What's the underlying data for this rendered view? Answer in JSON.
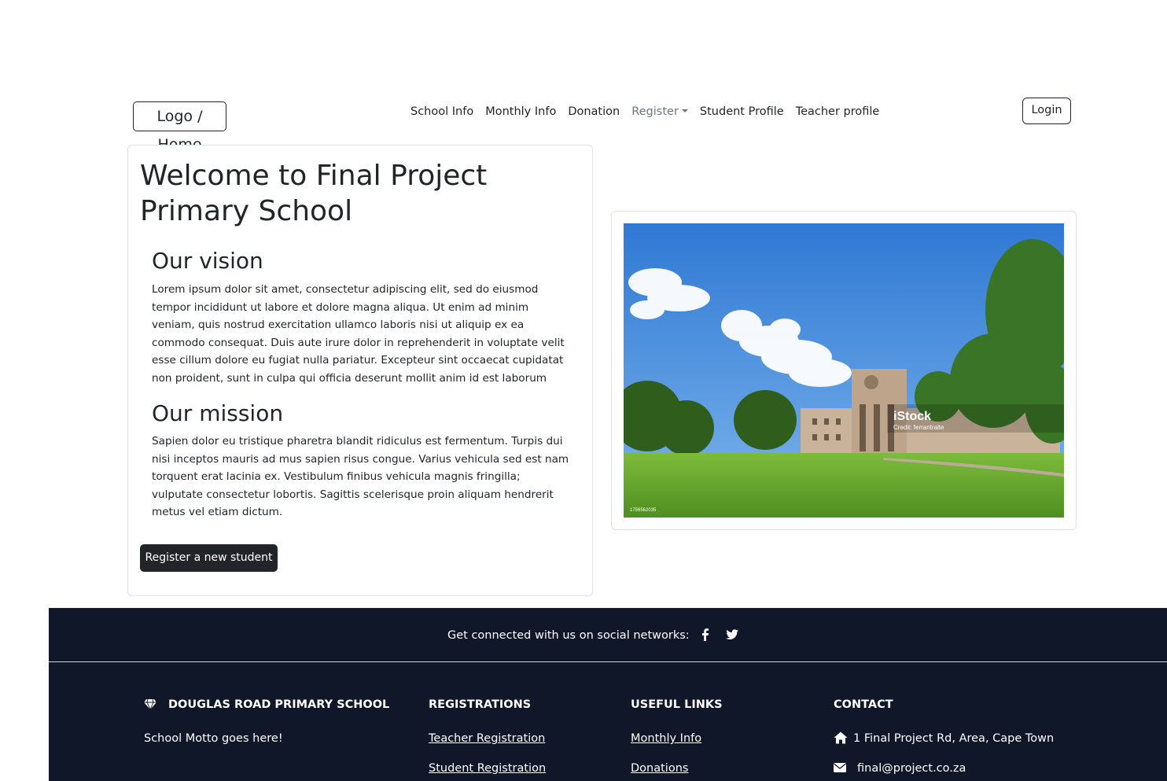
{
  "navbar": {
    "logo_label": "Logo / Home",
    "links": [
      "School Info",
      "Monthly Info",
      "Donation",
      "Register",
      "Student Profile",
      "Teacher profile"
    ],
    "login_label": "Login"
  },
  "main": {
    "title": "Welcome to Final Project Primary School",
    "vision_heading": "Our vision",
    "vision_text": "Lorem ipsum dolor sit amet, consectetur adipiscing elit, sed do eiusmod tempor incididunt ut labore et dolore magna aliqua. Ut enim ad minim veniam, quis nostrud exercitation ullamco laboris nisi ut aliquip ex ea commodo consequat. Duis aute irure dolor in reprehenderit in voluptate velit esse cillum dolore eu fugiat nulla pariatur. Excepteur sint occaecat cupidatat non proident, sunt in culpa qui officia deserunt mollit anim id est laborum",
    "mission_heading": "Our mission",
    "mission_text": "Sapien dolor eu tristique pharetra blandit ridiculus est fermentum. Turpis dui nisi inceptos mauris ad mus sapien risus congue. Varius vehicula sed est nam torquent erat lacinia ex. Vestibulum finibus vehicula magnis fringilla; vulputate consectetur lobortis. Sagittis scelerisque proin aliquam hendrerit metus vel etiam dictum.",
    "register_button": "Register a new student"
  },
  "photo": {
    "watermark_brand": "iStock",
    "watermark_credit": "Credit: ferrantraite",
    "watermark_id": "1756562035"
  },
  "footer": {
    "social_text": "Get connected with us on social networks:",
    "social_icons": [
      "facebook-icon",
      "twitter-icon"
    ],
    "col1_heading": "DOUGLAS ROAD PRIMARY SCHOOL",
    "col1_text": "School Motto goes here!",
    "col2_heading": "REGISTRATIONS",
    "col2_links": [
      "Teacher Registration",
      "Student Registration"
    ],
    "col3_heading": "USEFUL LINKS",
    "col3_links": [
      "Monthly Info",
      "Donations"
    ],
    "col4_heading": "CONTACT",
    "address": "1 Final Project Rd, Area, Cape Town",
    "email": "final@project.co.za"
  },
  "colors": {
    "footer_bg": "#0f1729",
    "button_dark": "#212529",
    "text": "#212529",
    "muted": "#6c757d"
  }
}
